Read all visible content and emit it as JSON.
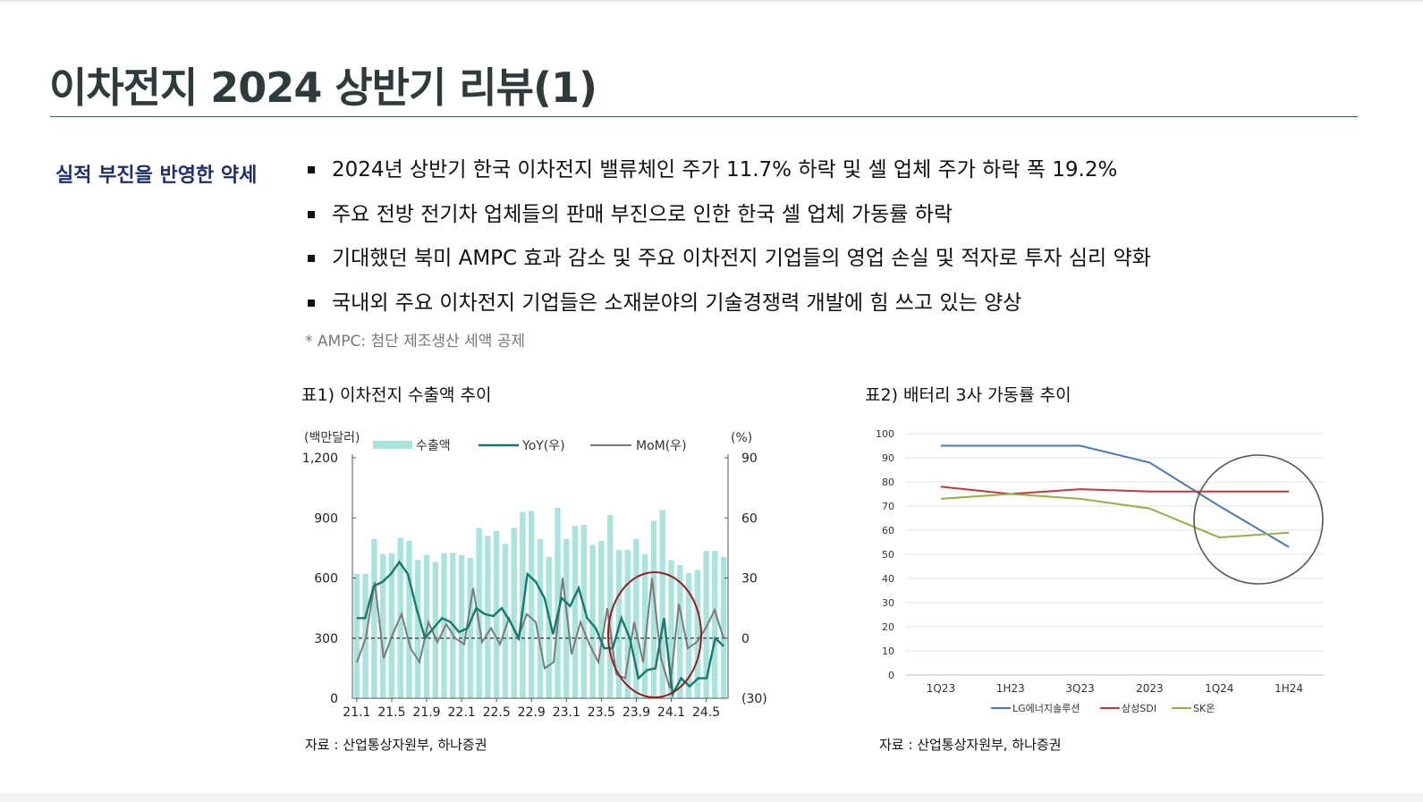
{
  "page": {
    "title": "이차전지 2024 상반기 리뷰(1)",
    "section_label": "실적 부진을 반영한 약세",
    "bullets": [
      "2024년 상반기 한국 이차전지 밸류체인 주가 11.7% 하락 및 셀 업체 주가 하락 폭 19.2%",
      "주요 전방 전기차 업체들의 판매 부진으로 인한 한국 셀 업체 가동률 하락",
      "기대했던 북미 AMPC 효과 감소 및 주요 이차전지 기업들의 영업 손실 및 적자로 투자 심리 약화",
      "국내외 주요 이차전지 기업들은 소재분야의 기술경쟁력 개발에 힘 쓰고 있는 양상"
    ],
    "footnote": "* AMPC: 첨단 제조생산 세액 공제"
  },
  "chart1_header": {
    "title": "표1) 이차전지 수출액 추이",
    "source": "자료 : 산업통상자원부, 하나증권"
  },
  "chart2_header": {
    "title": "표2) 배터리 3사 가동률 추이",
    "source": "자료 : 산업통상자원부, 하나증권"
  },
  "chart_data": [
    {
      "type": "bar",
      "title": "표1) 이차전지 수출액 추이",
      "left_unit": "(백만달러)",
      "right_unit": "(%)",
      "left_ticks": [
        "0",
        "300",
        "600",
        "900",
        "1,200"
      ],
      "left_ylim": [
        0,
        1200
      ],
      "right_ticks": [
        "(30)",
        "0",
        "30",
        "60",
        "90"
      ],
      "right_ylim": [
        -30,
        90
      ],
      "x_tick_labels": [
        "21.1",
        "21.5",
        "21.9",
        "22.1",
        "22.5",
        "22.9",
        "23.1",
        "23.5",
        "23.9",
        "24.1",
        "24.5"
      ],
      "legend": [
        "수출액",
        "YoY(우)",
        "MoM(우)"
      ],
      "colors": {
        "bars": "#a8e3de",
        "yoy": "#137a6d",
        "mom": "#7b7b7b",
        "zero_line": "#333333",
        "circle": "#9b1b1b"
      },
      "series": [
        {
          "name": "수출액",
          "axis": "left",
          "kind": "bar",
          "values": [
            620,
            620,
            795,
            720,
            725,
            800,
            785,
            690,
            715,
            680,
            725,
            725,
            715,
            700,
            850,
            810,
            835,
            770,
            850,
            930,
            935,
            795,
            705,
            950,
            795,
            860,
            865,
            765,
            785,
            915,
            740,
            740,
            795,
            720,
            885,
            940,
            690,
            665,
            625,
            640,
            735,
            735,
            705
          ]
        },
        {
          "name": "YoY(우)",
          "axis": "right",
          "kind": "line",
          "values": [
            10,
            10,
            26,
            28,
            32,
            38,
            32,
            15,
            0,
            5,
            10,
            8,
            3,
            5,
            15,
            12,
            11,
            15,
            8,
            0,
            32,
            28,
            20,
            2,
            20,
            16,
            25,
            10,
            5,
            -5,
            -5,
            10,
            0,
            -20,
            -16,
            -15,
            10,
            -28,
            -20,
            -24,
            -20,
            -20,
            0,
            -4
          ]
        },
        {
          "name": "MoM(우)",
          "axis": "right",
          "kind": "line",
          "values": [
            -12,
            0,
            28,
            -10,
            2,
            12,
            -5,
            -12,
            8,
            -2,
            7,
            0,
            -3,
            25,
            -2,
            5,
            -3,
            10,
            0,
            12,
            8,
            -15,
            -12,
            30,
            -8,
            8,
            -3,
            -12,
            15,
            -18,
            -20,
            8,
            -12,
            30,
            -10,
            -25,
            17,
            -5,
            -2,
            5,
            14,
            0
          ]
        }
      ]
    },
    {
      "type": "line",
      "title": "표2) 배터리 3사 가동률 추이",
      "categories": [
        "1Q23",
        "1H23",
        "3Q23",
        "2023",
        "1Q24",
        "1H24"
      ],
      "y_ticks": [
        "0",
        "10",
        "20",
        "30",
        "40",
        "50",
        "60",
        "70",
        "80",
        "90",
        "100"
      ],
      "ylim": [
        0,
        100
      ],
      "grid": true,
      "legend_position": "bottom",
      "series": [
        {
          "name": "LG에너지솔루션",
          "color": "#4a78b8",
          "values": [
            95,
            95,
            95,
            88,
            70,
            53
          ]
        },
        {
          "name": "삼성SDI",
          "color": "#c0393b",
          "values": [
            78,
            75,
            77,
            76,
            76,
            76
          ]
        },
        {
          "name": "SK온",
          "color": "#8fb244",
          "values": [
            73,
            75,
            73,
            69,
            57,
            59
          ]
        }
      ]
    }
  ]
}
